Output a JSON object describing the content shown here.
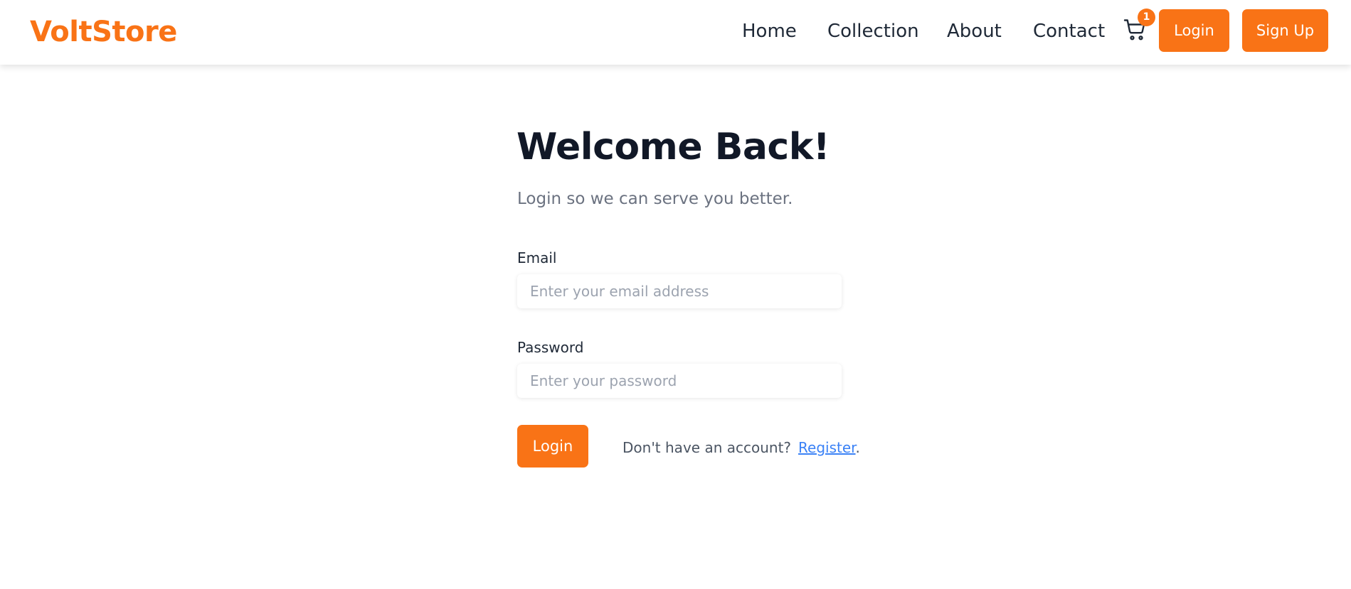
{
  "header": {
    "logo": "VoltStore",
    "nav": [
      "Home",
      "Collection",
      "About",
      "Contact"
    ],
    "cart_icon": "cart-icon",
    "cart_count": "1",
    "login_label": "Login",
    "signup_label": "Sign Up"
  },
  "main": {
    "title": "Welcome Back!",
    "subtitle": "Login so we can serve you better.",
    "email_label": "Email",
    "email_value": "",
    "email_placeholder": "Enter your email address",
    "password_label": "Password",
    "password_value": "",
    "password_placeholder": "Enter your password",
    "login_button": "Login",
    "no_account_text": "Don't have an account?",
    "register_link": "Register",
    "register_suffix": "."
  },
  "colors": {
    "brand": "#f97316",
    "link": "#3b82f6",
    "heading": "#111827"
  }
}
